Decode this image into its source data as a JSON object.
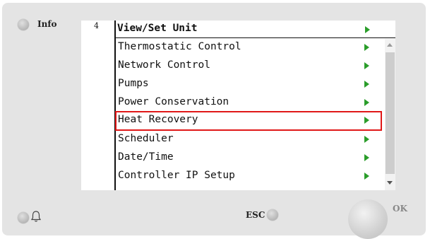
{
  "device": {
    "info_label": "Info",
    "esc_label": "ESC",
    "ok_label": "OK"
  },
  "screen": {
    "page_number": "4",
    "title": "View/Set Unit",
    "items": [
      {
        "label": "Thermostatic Control"
      },
      {
        "label": "Network Control"
      },
      {
        "label": "Pumps"
      },
      {
        "label": "Power Conservation"
      },
      {
        "label": "Heat Recovery",
        "selected": true
      },
      {
        "label": "Scheduler"
      },
      {
        "label": "Date/Time"
      },
      {
        "label": "Controller IP Setup"
      }
    ]
  },
  "colors": {
    "arrow": "#2a9d2a",
    "selection_outline": "#e01818"
  },
  "icons": {
    "bell": "bell-icon",
    "arrow": "play-arrow-icon"
  }
}
